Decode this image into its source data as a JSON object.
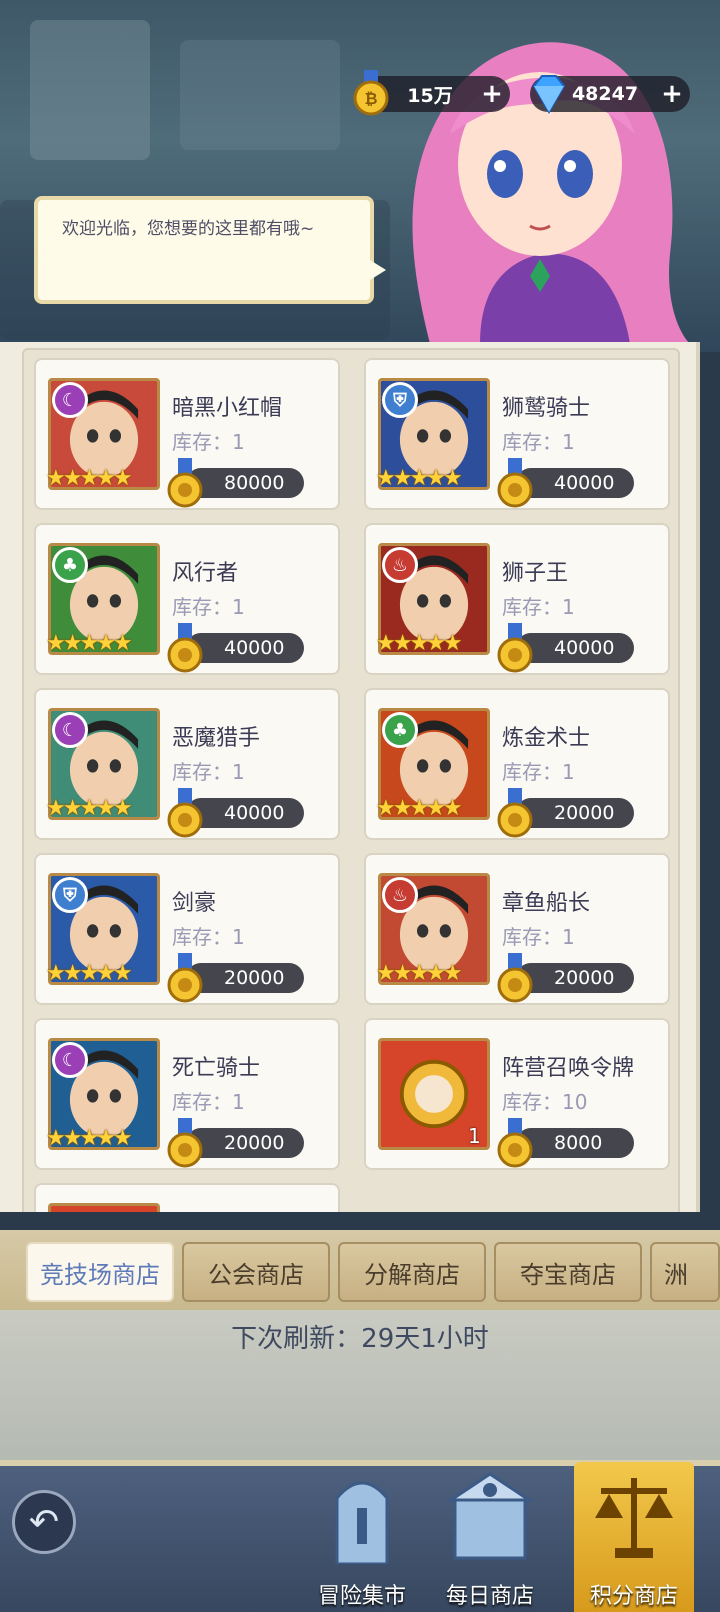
{
  "currencies": [
    {
      "value": "15万",
      "icon": "gold-medal-icon",
      "plus": "+"
    },
    {
      "value": "48247",
      "icon": "diamond-icon",
      "plus": "+"
    }
  ],
  "npc_greeting": "欢迎光临，您想要的这里都有哦~",
  "items": [
    {
      "name": "暗黑小红帽",
      "stock": "库存：1",
      "price": "80000",
      "stars": "★★★★★",
      "faction": "moon",
      "color": "#c84a3a"
    },
    {
      "name": "狮鹫骑士",
      "stock": "库存：1",
      "price": "40000",
      "stars": "★★★★★",
      "faction": "helm",
      "color": "#2d4f9b"
    },
    {
      "name": "风行者",
      "stock": "库存：1",
      "price": "40000",
      "stars": "★★★★★",
      "faction": "tree",
      "color": "#3f8d3a"
    },
    {
      "name": "狮子王",
      "stock": "库存：1",
      "price": "40000",
      "stars": "★★★★★",
      "faction": "fire",
      "color": "#9a2a20"
    },
    {
      "name": "恶魔猎手",
      "stock": "库存：1",
      "price": "40000",
      "stars": "★★★★★",
      "faction": "moon",
      "color": "#3f8d77"
    },
    {
      "name": "炼金术士",
      "stock": "库存：1",
      "price": "20000",
      "stars": "★★★★★",
      "faction": "tree",
      "color": "#c6481c"
    },
    {
      "name": "剑豪",
      "stock": "库存：1",
      "price": "20000",
      "stars": "★★★★★",
      "faction": "helm",
      "color": "#2a5aa8"
    },
    {
      "name": "章鱼船长",
      "stock": "库存：1",
      "price": "20000",
      "stars": "★★★★★",
      "faction": "fire",
      "color": "#c24a33"
    },
    {
      "name": "死亡骑士",
      "stock": "库存：1",
      "price": "20000",
      "stars": "★★★★★",
      "faction": "moon",
      "color": "#1f5f93"
    },
    {
      "name": "阵营召唤令牌",
      "stock": "库存：10",
      "price": "8000",
      "stars": "",
      "qty": "1",
      "faction": "",
      "color": "#d6452a"
    }
  ],
  "tabs": [
    "竞技场商店",
    "公会商店",
    "分解商店",
    "夺宝商店",
    "洲"
  ],
  "refresh_text": "下次刷新：29天1小时",
  "bottom_nav": [
    {
      "label": "冒险集市",
      "icon": "tower-icon"
    },
    {
      "label": "每日商店",
      "icon": "shop-icon"
    },
    {
      "label": "积分商店",
      "icon": "scale-icon"
    }
  ]
}
